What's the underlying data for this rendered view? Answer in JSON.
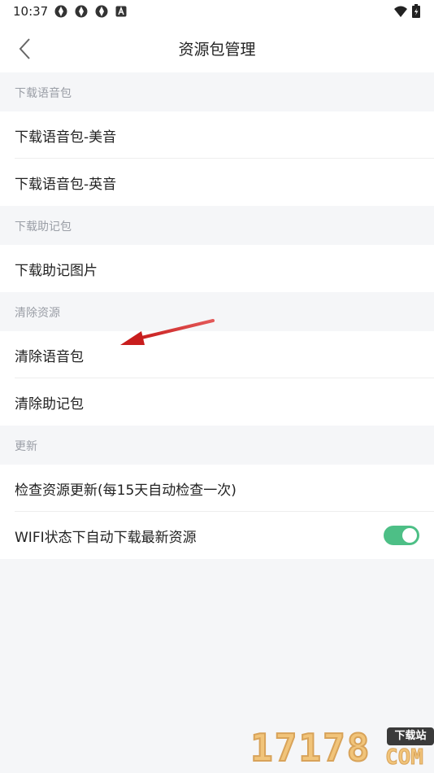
{
  "status_bar": {
    "time": "10:37",
    "icons": [
      "app-icon",
      "app-icon",
      "app-icon",
      "keyboard-icon",
      "wifi-icon",
      "battery-icon"
    ]
  },
  "header": {
    "title": "资源包管理"
  },
  "sections": [
    {
      "header": "下载语音包",
      "items": [
        {
          "label": "下载语音包-美音"
        },
        {
          "label": "下载语音包-英音"
        }
      ]
    },
    {
      "header": "下载助记包",
      "items": [
        {
          "label": "下载助记图片"
        }
      ]
    },
    {
      "header": "清除资源",
      "items": [
        {
          "label": "清除语音包"
        },
        {
          "label": "清除助记包"
        }
      ]
    },
    {
      "header": "更新",
      "items": [
        {
          "label": "检查资源更新(每15天自动检查一次)"
        },
        {
          "label": "WIFI状态下自动下载最新资源",
          "toggle": true
        }
      ]
    }
  ],
  "watermark": {
    "digits": "17178",
    "badge": "下载站",
    "suffix": "COM"
  },
  "colors": {
    "toggle_on": "#4dbf86",
    "annotation_arrow": "#d42a2a",
    "section_text": "#9a9ea6"
  }
}
